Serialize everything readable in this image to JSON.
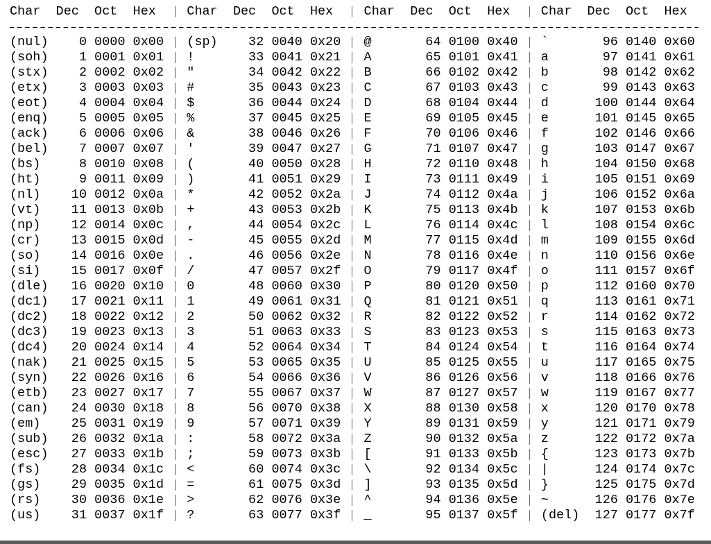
{
  "table": {
    "columns": [
      "Char",
      "Dec",
      "Oct",
      "Hex",
      "Char",
      "Dec",
      "Oct",
      "Hex",
      "Char",
      "Dec",
      "Oct",
      "Hex",
      "Char",
      "Dec",
      "Oct",
      "Hex"
    ],
    "rows": [
      [
        "(nul)",
        "0",
        "0000",
        "0x00",
        "(sp)",
        "32",
        "0040",
        "0x20",
        "@",
        "64",
        "0100",
        "0x40",
        "`",
        "96",
        "0140",
        "0x60"
      ],
      [
        "(soh)",
        "1",
        "0001",
        "0x01",
        "!",
        "33",
        "0041",
        "0x21",
        "A",
        "65",
        "0101",
        "0x41",
        "a",
        "97",
        "0141",
        "0x61"
      ],
      [
        "(stx)",
        "2",
        "0002",
        "0x02",
        "\"",
        "34",
        "0042",
        "0x22",
        "B",
        "66",
        "0102",
        "0x42",
        "b",
        "98",
        "0142",
        "0x62"
      ],
      [
        "(etx)",
        "3",
        "0003",
        "0x03",
        "#",
        "35",
        "0043",
        "0x23",
        "C",
        "67",
        "0103",
        "0x43",
        "c",
        "99",
        "0143",
        "0x63"
      ],
      [
        "(eot)",
        "4",
        "0004",
        "0x04",
        "$",
        "36",
        "0044",
        "0x24",
        "D",
        "68",
        "0104",
        "0x44",
        "d",
        "100",
        "0144",
        "0x64"
      ],
      [
        "(enq)",
        "5",
        "0005",
        "0x05",
        "%",
        "37",
        "0045",
        "0x25",
        "E",
        "69",
        "0105",
        "0x45",
        "e",
        "101",
        "0145",
        "0x65"
      ],
      [
        "(ack)",
        "6",
        "0006",
        "0x06",
        "&",
        "38",
        "0046",
        "0x26",
        "F",
        "70",
        "0106",
        "0x46",
        "f",
        "102",
        "0146",
        "0x66"
      ],
      [
        "(bel)",
        "7",
        "0007",
        "0x07",
        "'",
        "39",
        "0047",
        "0x27",
        "G",
        "71",
        "0107",
        "0x47",
        "g",
        "103",
        "0147",
        "0x67"
      ],
      [
        "(bs)",
        "8",
        "0010",
        "0x08",
        "(",
        "40",
        "0050",
        "0x28",
        "H",
        "72",
        "0110",
        "0x48",
        "h",
        "104",
        "0150",
        "0x68"
      ],
      [
        "(ht)",
        "9",
        "0011",
        "0x09",
        ")",
        "41",
        "0051",
        "0x29",
        "I",
        "73",
        "0111",
        "0x49",
        "i",
        "105",
        "0151",
        "0x69"
      ],
      [
        "(nl)",
        "10",
        "0012",
        "0x0a",
        "*",
        "42",
        "0052",
        "0x2a",
        "J",
        "74",
        "0112",
        "0x4a",
        "j",
        "106",
        "0152",
        "0x6a"
      ],
      [
        "(vt)",
        "11",
        "0013",
        "0x0b",
        "+",
        "43",
        "0053",
        "0x2b",
        "K",
        "75",
        "0113",
        "0x4b",
        "k",
        "107",
        "0153",
        "0x6b"
      ],
      [
        "(np)",
        "12",
        "0014",
        "0x0c",
        ",",
        "44",
        "0054",
        "0x2c",
        "L",
        "76",
        "0114",
        "0x4c",
        "l",
        "108",
        "0154",
        "0x6c"
      ],
      [
        "(cr)",
        "13",
        "0015",
        "0x0d",
        "-",
        "45",
        "0055",
        "0x2d",
        "M",
        "77",
        "0115",
        "0x4d",
        "m",
        "109",
        "0155",
        "0x6d"
      ],
      [
        "(so)",
        "14",
        "0016",
        "0x0e",
        ".",
        "46",
        "0056",
        "0x2e",
        "N",
        "78",
        "0116",
        "0x4e",
        "n",
        "110",
        "0156",
        "0x6e"
      ],
      [
        "(si)",
        "15",
        "0017",
        "0x0f",
        "/",
        "47",
        "0057",
        "0x2f",
        "O",
        "79",
        "0117",
        "0x4f",
        "o",
        "111",
        "0157",
        "0x6f"
      ],
      [
        "(dle)",
        "16",
        "0020",
        "0x10",
        "0",
        "48",
        "0060",
        "0x30",
        "P",
        "80",
        "0120",
        "0x50",
        "p",
        "112",
        "0160",
        "0x70"
      ],
      [
        "(dc1)",
        "17",
        "0021",
        "0x11",
        "1",
        "49",
        "0061",
        "0x31",
        "Q",
        "81",
        "0121",
        "0x51",
        "q",
        "113",
        "0161",
        "0x71"
      ],
      [
        "(dc2)",
        "18",
        "0022",
        "0x12",
        "2",
        "50",
        "0062",
        "0x32",
        "R",
        "82",
        "0122",
        "0x52",
        "r",
        "114",
        "0162",
        "0x72"
      ],
      [
        "(dc3)",
        "19",
        "0023",
        "0x13",
        "3",
        "51",
        "0063",
        "0x33",
        "S",
        "83",
        "0123",
        "0x53",
        "s",
        "115",
        "0163",
        "0x73"
      ],
      [
        "(dc4)",
        "20",
        "0024",
        "0x14",
        "4",
        "52",
        "0064",
        "0x34",
        "T",
        "84",
        "0124",
        "0x54",
        "t",
        "116",
        "0164",
        "0x74"
      ],
      [
        "(nak)",
        "21",
        "0025",
        "0x15",
        "5",
        "53",
        "0065",
        "0x35",
        "U",
        "85",
        "0125",
        "0x55",
        "u",
        "117",
        "0165",
        "0x75"
      ],
      [
        "(syn)",
        "22",
        "0026",
        "0x16",
        "6",
        "54",
        "0066",
        "0x36",
        "V",
        "86",
        "0126",
        "0x56",
        "v",
        "118",
        "0166",
        "0x76"
      ],
      [
        "(etb)",
        "23",
        "0027",
        "0x17",
        "7",
        "55",
        "0067",
        "0x37",
        "W",
        "87",
        "0127",
        "0x57",
        "w",
        "119",
        "0167",
        "0x77"
      ],
      [
        "(can)",
        "24",
        "0030",
        "0x18",
        "8",
        "56",
        "0070",
        "0x38",
        "X",
        "88",
        "0130",
        "0x58",
        "x",
        "120",
        "0170",
        "0x78"
      ],
      [
        "(em)",
        "25",
        "0031",
        "0x19",
        "9",
        "57",
        "0071",
        "0x39",
        "Y",
        "89",
        "0131",
        "0x59",
        "y",
        "121",
        "0171",
        "0x79"
      ],
      [
        "(sub)",
        "26",
        "0032",
        "0x1a",
        ":",
        "58",
        "0072",
        "0x3a",
        "Z",
        "90",
        "0132",
        "0x5a",
        "z",
        "122",
        "0172",
        "0x7a"
      ],
      [
        "(esc)",
        "27",
        "0033",
        "0x1b",
        ";",
        "59",
        "0073",
        "0x3b",
        "[",
        "91",
        "0133",
        "0x5b",
        "{",
        "123",
        "0173",
        "0x7b"
      ],
      [
        "(fs)",
        "28",
        "0034",
        "0x1c",
        "<",
        "60",
        "0074",
        "0x3c",
        "\\",
        "92",
        "0134",
        "0x5c",
        "|",
        "124",
        "0174",
        "0x7c"
      ],
      [
        "(gs)",
        "29",
        "0035",
        "0x1d",
        "=",
        "61",
        "0075",
        "0x3d",
        "]",
        "93",
        "0135",
        "0x5d",
        "}",
        "125",
        "0175",
        "0x7d"
      ],
      [
        "(rs)",
        "30",
        "0036",
        "0x1e",
        ">",
        "62",
        "0076",
        "0x3e",
        "^",
        "94",
        "0136",
        "0x5e",
        "~",
        "126",
        "0176",
        "0x7e"
      ],
      [
        "(us)",
        "31",
        "0037",
        "0x1f",
        "?",
        "63",
        "0077",
        "0x3f",
        "_",
        "95",
        "0137",
        "0x5f",
        "(del)",
        "127",
        "0177",
        "0x7f"
      ]
    ]
  }
}
